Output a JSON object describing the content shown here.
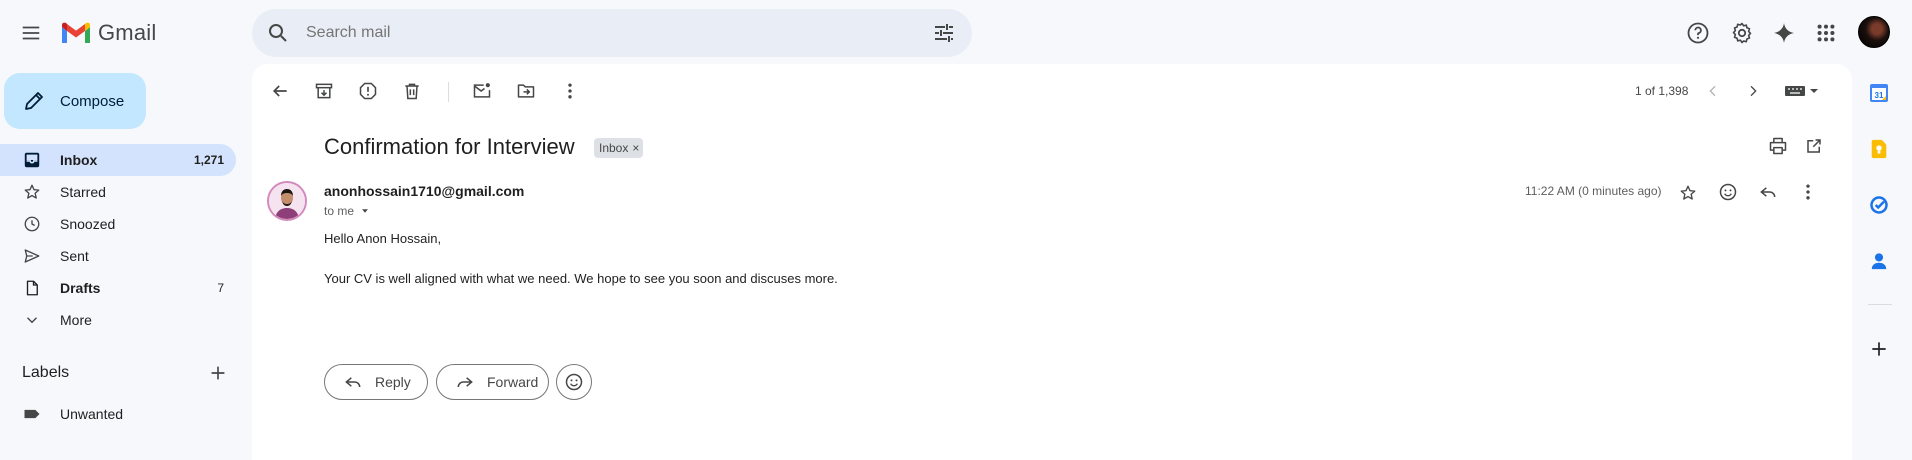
{
  "app": {
    "name": "Gmail"
  },
  "search": {
    "placeholder": "Search mail"
  },
  "sidebar": {
    "compose_label": "Compose",
    "items": [
      {
        "label": "Inbox",
        "count": "1,271",
        "icon": "inbox-icon"
      },
      {
        "label": "Starred",
        "count": "",
        "icon": "star-icon"
      },
      {
        "label": "Snoozed",
        "count": "",
        "icon": "clock-icon"
      },
      {
        "label": "Sent",
        "count": "",
        "icon": "send-icon"
      },
      {
        "label": "Drafts",
        "count": "7",
        "icon": "draft-icon"
      },
      {
        "label": "More",
        "count": "",
        "icon": "chevron-down-icon"
      }
    ],
    "labels_title": "Labels",
    "labels": [
      {
        "label": "Unwanted",
        "icon": "label-icon"
      }
    ]
  },
  "toolbar": {
    "pager": "1 of 1,398"
  },
  "email": {
    "subject": "Confirmation for Interview",
    "badge": "Inbox",
    "badge_remove": "×",
    "sender": "anonhossain1710@gmail.com",
    "recipient": "to me",
    "time": "11:22 AM (0 minutes ago)",
    "greeting": "Hello Anon Hossain,",
    "body": "Your CV is well aligned with what we need. We hope to see you soon and discuses more.",
    "reply_label": "Reply",
    "forward_label": "Forward"
  },
  "side_panel": {
    "calendar_day": "31"
  },
  "colors": {
    "background": "#f6f8fc",
    "compose": "#c2e7ff",
    "active_nav": "#d3e3fd",
    "search": "#e9eef6"
  }
}
